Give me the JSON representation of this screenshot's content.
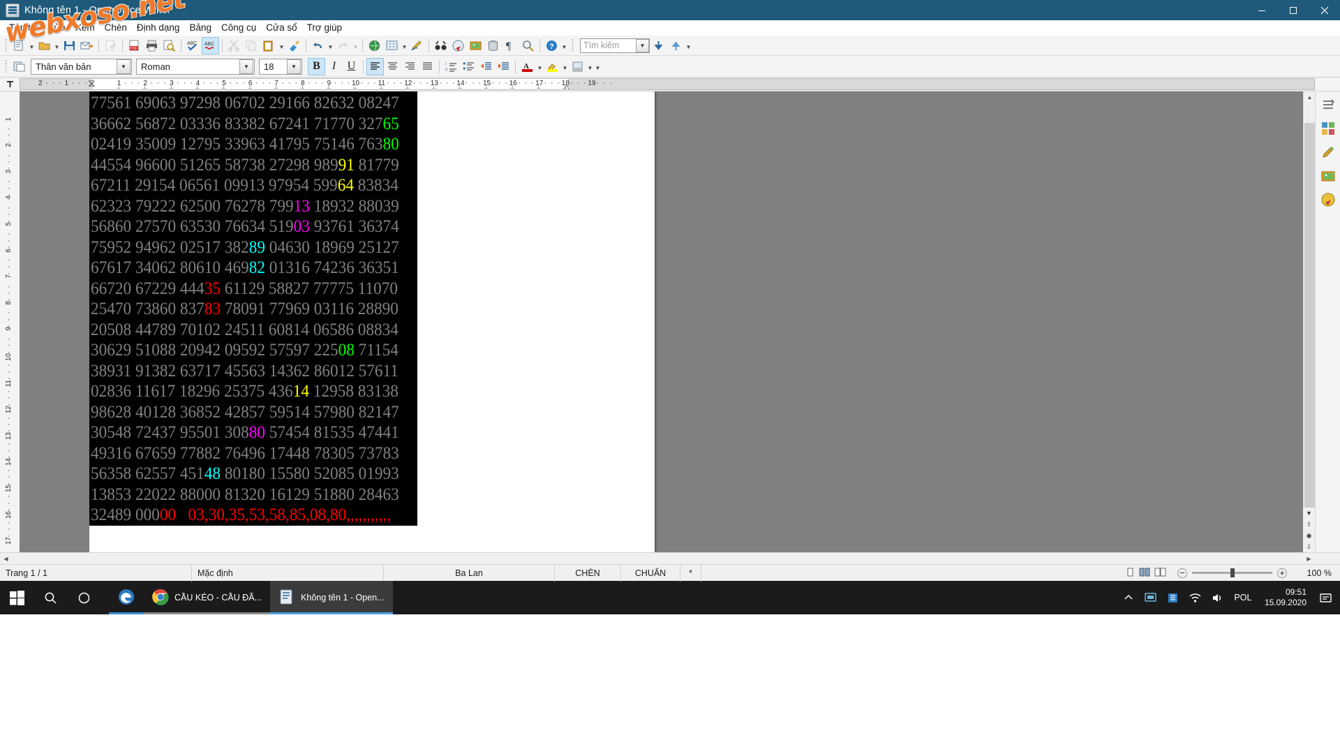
{
  "window": {
    "title": "Không tên 1 - OpenOffice Writer",
    "app_icon": "writer-icon",
    "minimize": "–",
    "maximize": "☐",
    "close": "✕"
  },
  "watermark": {
    "text": "webxoso.net"
  },
  "menubar": {
    "items": [
      {
        "label": "Tập tin"
      },
      {
        "label": "Sửa"
      },
      {
        "label": "Xem"
      },
      {
        "label": "Chèn"
      },
      {
        "label": "Định dạng"
      },
      {
        "label": "Bảng"
      },
      {
        "label": "Công cụ"
      },
      {
        "label": "Cửa sổ"
      },
      {
        "label": "Trợ giúp"
      }
    ]
  },
  "standard_toolbar": {
    "buttons": [
      {
        "name": "new-document",
        "glyph": "📄",
        "state": "enabled"
      },
      {
        "name": "open-document",
        "glyph": "📂",
        "state": "enabled"
      },
      {
        "name": "save-document",
        "glyph": "💾",
        "state": "enabled"
      },
      {
        "name": "send-email",
        "glyph": "✉",
        "state": "enabled"
      },
      {
        "name": "edit-file",
        "glyph": "✎",
        "state": "disabled"
      },
      {
        "name": "export-pdf",
        "glyph": "PDF",
        "state": "enabled"
      },
      {
        "name": "print-document",
        "glyph": "🖨",
        "state": "enabled"
      },
      {
        "name": "print-preview",
        "glyph": "🔍",
        "state": "enabled"
      },
      {
        "name": "spelling-check",
        "glyph": "ABC",
        "state": "enabled"
      },
      {
        "name": "autospellcheck",
        "glyph": "ABC",
        "state": "active"
      },
      {
        "name": "cut",
        "glyph": "✂",
        "state": "disabled"
      },
      {
        "name": "copy",
        "glyph": "⧉",
        "state": "disabled"
      },
      {
        "name": "paste",
        "glyph": "📋",
        "state": "enabled"
      },
      {
        "name": "clone-formatting",
        "glyph": "🖌",
        "state": "enabled"
      },
      {
        "name": "undo",
        "glyph": "↶",
        "state": "enabled"
      },
      {
        "name": "redo",
        "glyph": "↷",
        "state": "disabled"
      },
      {
        "name": "hyperlink",
        "glyph": "🌐",
        "state": "enabled"
      },
      {
        "name": "insert-table",
        "glyph": "▦",
        "state": "enabled"
      },
      {
        "name": "show-draw-functions",
        "glyph": "✏",
        "state": "enabled"
      },
      {
        "name": "find-and-replace",
        "glyph": "🔭",
        "state": "enabled"
      },
      {
        "name": "navigator",
        "glyph": "🧭",
        "state": "enabled"
      },
      {
        "name": "gallery",
        "glyph": "🖼",
        "state": "enabled"
      },
      {
        "name": "data-sources",
        "glyph": "🗄",
        "state": "enabled"
      },
      {
        "name": "formatting-marks",
        "glyph": "¶",
        "state": "enabled"
      },
      {
        "name": "zoom",
        "glyph": "🔎",
        "state": "enabled"
      },
      {
        "name": "openoffice-help",
        "glyph": "?",
        "state": "enabled"
      }
    ],
    "search": {
      "placeholder": "Tìm kiếm",
      "value": "",
      "find-next": "⬇",
      "find-previous": "⬆"
    }
  },
  "format_toolbar": {
    "styles_apply_icon": "paragraph-style-icon",
    "paragraph_style": "Thân văn bản",
    "font_name": "Roman",
    "font_size": "18",
    "bold": {
      "label": "B",
      "active": true
    },
    "italic": {
      "label": "I",
      "active": false
    },
    "underline": {
      "label": "U",
      "active": false
    },
    "align_left": {
      "name": "align-left",
      "active": true
    },
    "align_center": {
      "name": "align-center",
      "active": false
    },
    "align_right": {
      "name": "align-right",
      "active": false
    },
    "align_justify": {
      "name": "align-justify",
      "active": false
    },
    "numbered_list": {
      "name": "ordered-list-icon"
    },
    "bulleted_list": {
      "name": "unordered-list-icon"
    },
    "decrease_indent": {
      "name": "decrease-indent-icon"
    },
    "increase_indent": {
      "name": "increase-indent-icon"
    },
    "font_color": {
      "name": "font-color-icon",
      "swatch": "#cc0000"
    },
    "highlight_color": {
      "name": "highlight-color-icon",
      "swatch": "#ffff00"
    },
    "background_color": {
      "name": "background-color-icon",
      "swatch": "#cccccc"
    }
  },
  "ruler": {
    "corner_icon": "tab-stop-icon",
    "h_labels": [
      "2",
      "1",
      "1",
      "2",
      "3",
      "4",
      "5",
      "6",
      "7",
      "8",
      "9",
      "10",
      "11",
      "12",
      "13",
      "14",
      "15",
      "16",
      "17",
      "18"
    ],
    "v_labels": [
      "1",
      "2",
      "3",
      "4",
      "5",
      "6",
      "7",
      "8",
      "9",
      "10",
      "11",
      "12",
      "13",
      "14",
      "15",
      "16",
      "17"
    ]
  },
  "document": {
    "text_color": "#808080",
    "background_color": "#000000",
    "lines": [
      {
        "cells": [
          {
            "t": "77561 69063 97298 06702 29166 82632 08247",
            "c": "#808080"
          }
        ]
      },
      {
        "cells": [
          {
            "t": "36662 56872 03336 83382 67241 71770 327",
            "c": "#808080"
          },
          {
            "t": "65",
            "c": "#00ff00"
          }
        ]
      },
      {
        "cells": [
          {
            "t": "02419 35009 12795 33963 41795 75146 763",
            "c": "#808080"
          },
          {
            "t": "80",
            "c": "#00ff00"
          }
        ]
      },
      {
        "cells": [
          {
            "t": "44554 96600 51265 58738 27298 989",
            "c": "#808080"
          },
          {
            "t": "91",
            "c": "#ffff00"
          },
          {
            "t": " 81779",
            "c": "#808080"
          }
        ]
      },
      {
        "cells": [
          {
            "t": "67211 29154 06561 09913 97954 599",
            "c": "#808080"
          },
          {
            "t": "64",
            "c": "#ffff00"
          },
          {
            "t": " 83834",
            "c": "#808080"
          }
        ]
      },
      {
        "cells": [
          {
            "t": "62323 79222 62500 76278 799",
            "c": "#808080"
          },
          {
            "t": "13",
            "c": "#ff00ff"
          },
          {
            "t": " 18932 88039",
            "c": "#808080"
          }
        ]
      },
      {
        "cells": [
          {
            "t": "56860 27570 63530 76634 519",
            "c": "#808080"
          },
          {
            "t": "03",
            "c": "#ff00ff"
          },
          {
            "t": " 93761 36374",
            "c": "#808080"
          }
        ]
      },
      {
        "cells": [
          {
            "t": "75952 94962 02517 382",
            "c": "#808080"
          },
          {
            "t": "89",
            "c": "#00ffff"
          },
          {
            "t": " 04630 18969 25127",
            "c": "#808080"
          }
        ]
      },
      {
        "cells": [
          {
            "t": "67617 34062 80610 469",
            "c": "#808080"
          },
          {
            "t": "82",
            "c": "#00ffff"
          },
          {
            "t": " 01316 74236 36351",
            "c": "#808080"
          }
        ]
      },
      {
        "cells": [
          {
            "t": "66720 67229 444",
            "c": "#808080"
          },
          {
            "t": "35",
            "c": "#ff0000"
          },
          {
            "t": " 61129 58827 77775 11070",
            "c": "#808080"
          }
        ]
      },
      {
        "cells": [
          {
            "t": "25470 73860 837",
            "c": "#808080"
          },
          {
            "t": "83",
            "c": "#ff0000"
          },
          {
            "t": " 78091 77969 03116 28890",
            "c": "#808080"
          }
        ]
      },
      {
        "cells": [
          {
            "t": "20508 44789 70102 24511 60814 06586 08834",
            "c": "#808080"
          }
        ]
      },
      {
        "cells": [
          {
            "t": "30629 51088 20942 09592 57597 225",
            "c": "#808080"
          },
          {
            "t": "08",
            "c": "#00ff00"
          },
          {
            "t": " 71154",
            "c": "#808080"
          }
        ]
      },
      {
        "cells": [
          {
            "t": "38931 91382 63717 45563 14362 86012 57611",
            "c": "#808080"
          }
        ]
      },
      {
        "cells": [
          {
            "t": "02836 11617 18296 25375 436",
            "c": "#808080"
          },
          {
            "t": "14",
            "c": "#ffff00"
          },
          {
            "t": " 12958 83138",
            "c": "#808080"
          }
        ]
      },
      {
        "cells": [
          {
            "t": "98628 40128 36852 42857 59514 57980 82147",
            "c": "#808080"
          }
        ]
      },
      {
        "cells": [
          {
            "t": "30548 72437 95501 308",
            "c": "#808080"
          },
          {
            "t": "80",
            "c": "#ff00ff"
          },
          {
            "t": " 57454 81535 47441",
            "c": "#808080"
          }
        ]
      },
      {
        "cells": [
          {
            "t": "49316 67659 77882 76496 17448 78305 73783",
            "c": "#808080"
          }
        ]
      },
      {
        "cells": [
          {
            "t": "56358 62557 451",
            "c": "#808080"
          },
          {
            "t": "48",
            "c": "#00ffff"
          },
          {
            "t": " 80180 15580 52085 01993",
            "c": "#808080"
          }
        ]
      },
      {
        "cells": [
          {
            "t": "13853 22022 88000 81320 16129 51880 28463",
            "c": "#808080"
          }
        ]
      },
      {
        "cells": [
          {
            "t": "32489 000",
            "c": "#808080"
          },
          {
            "t": "00",
            "c": "#ff0000"
          },
          {
            "t": "   ",
            "c": "#808080"
          },
          {
            "t": "03,30,35,53,58,85,08,80,,,,,,,,,,,",
            "c": "#ff0000"
          }
        ]
      }
    ]
  },
  "right_sidebar": {
    "items": [
      {
        "name": "sidebar-settings",
        "glyph": "☰"
      },
      {
        "name": "sidebar-properties",
        "glyph": "▦"
      },
      {
        "name": "sidebar-styles",
        "glyph": "🎨"
      },
      {
        "name": "sidebar-gallery",
        "glyph": "🖼"
      },
      {
        "name": "sidebar-navigator",
        "glyph": "🧭"
      }
    ]
  },
  "statusbar": {
    "page": "Trang 1 / 1",
    "page_style": "Mặc định",
    "language": "Ba Lan",
    "insert_mode": "CHÈN",
    "selection_mode": "CHUẨN",
    "modified": "*",
    "view_layout_icons": [
      "single-page-view",
      "multi-page-view",
      "book-view"
    ],
    "zoom_out": "−",
    "zoom_in": "+",
    "zoom_level": "100 %"
  },
  "taskbar": {
    "start": "windows-logo-icon",
    "search": "search-icon",
    "taskview": "task-view-icon",
    "items": [
      {
        "name": "taskbar-edge",
        "icon": "edge-icon",
        "label": "",
        "accent": "#3a8fd4"
      },
      {
        "name": "taskbar-chrome",
        "icon": "chrome-icon",
        "label": "CẦU KÉO - CẦU ĐÃ...",
        "accent": "#7a7a7a"
      },
      {
        "name": "taskbar-writer",
        "icon": "writer-icon",
        "label": "Không tên 1 - Open...",
        "accent": "#3a8fd4",
        "active": true
      }
    ],
    "tray": {
      "show_hidden": "⌃",
      "icons": [
        "screen-snip-icon",
        "onedrive-icon",
        "wifi-icon",
        "volume-icon"
      ],
      "language": "POL",
      "time": "09:51",
      "date": "15.09.2020",
      "notifications": "notification-icon"
    }
  }
}
